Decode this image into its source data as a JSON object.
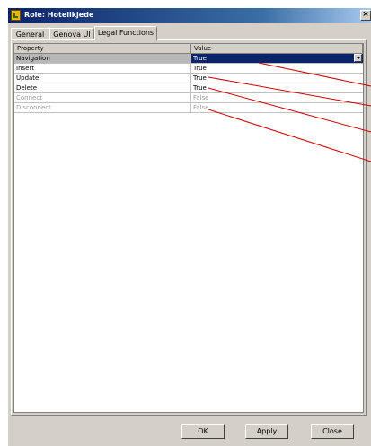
{
  "window": {
    "title": "Role: Hotellkjede",
    "close_label": "×"
  },
  "tabs": [
    {
      "label": "General",
      "active": false
    },
    {
      "label": "Genova UI",
      "active": false
    },
    {
      "label": "Legal Functions",
      "active": true
    }
  ],
  "grid": {
    "columns": [
      "Property",
      "Value"
    ],
    "rows": [
      {
        "property": "Navigation",
        "value": "True",
        "selected": true,
        "enabled": true
      },
      {
        "property": "Insert",
        "value": "True",
        "selected": false,
        "enabled": true
      },
      {
        "property": "Update",
        "value": "True",
        "selected": false,
        "enabled": true
      },
      {
        "property": "Delete",
        "value": "True",
        "selected": false,
        "enabled": true
      },
      {
        "property": "Connect",
        "value": "False",
        "selected": false,
        "enabled": false
      },
      {
        "property": "Disconnect",
        "value": "False",
        "selected": false,
        "enabled": false
      }
    ]
  },
  "buttons": {
    "ok": "OK",
    "apply": "Apply",
    "close": "Close"
  },
  "colors": {
    "selection": "#0a246a",
    "annotation_line": "#cc0000",
    "dialog_bg": "#d4d0c8"
  }
}
